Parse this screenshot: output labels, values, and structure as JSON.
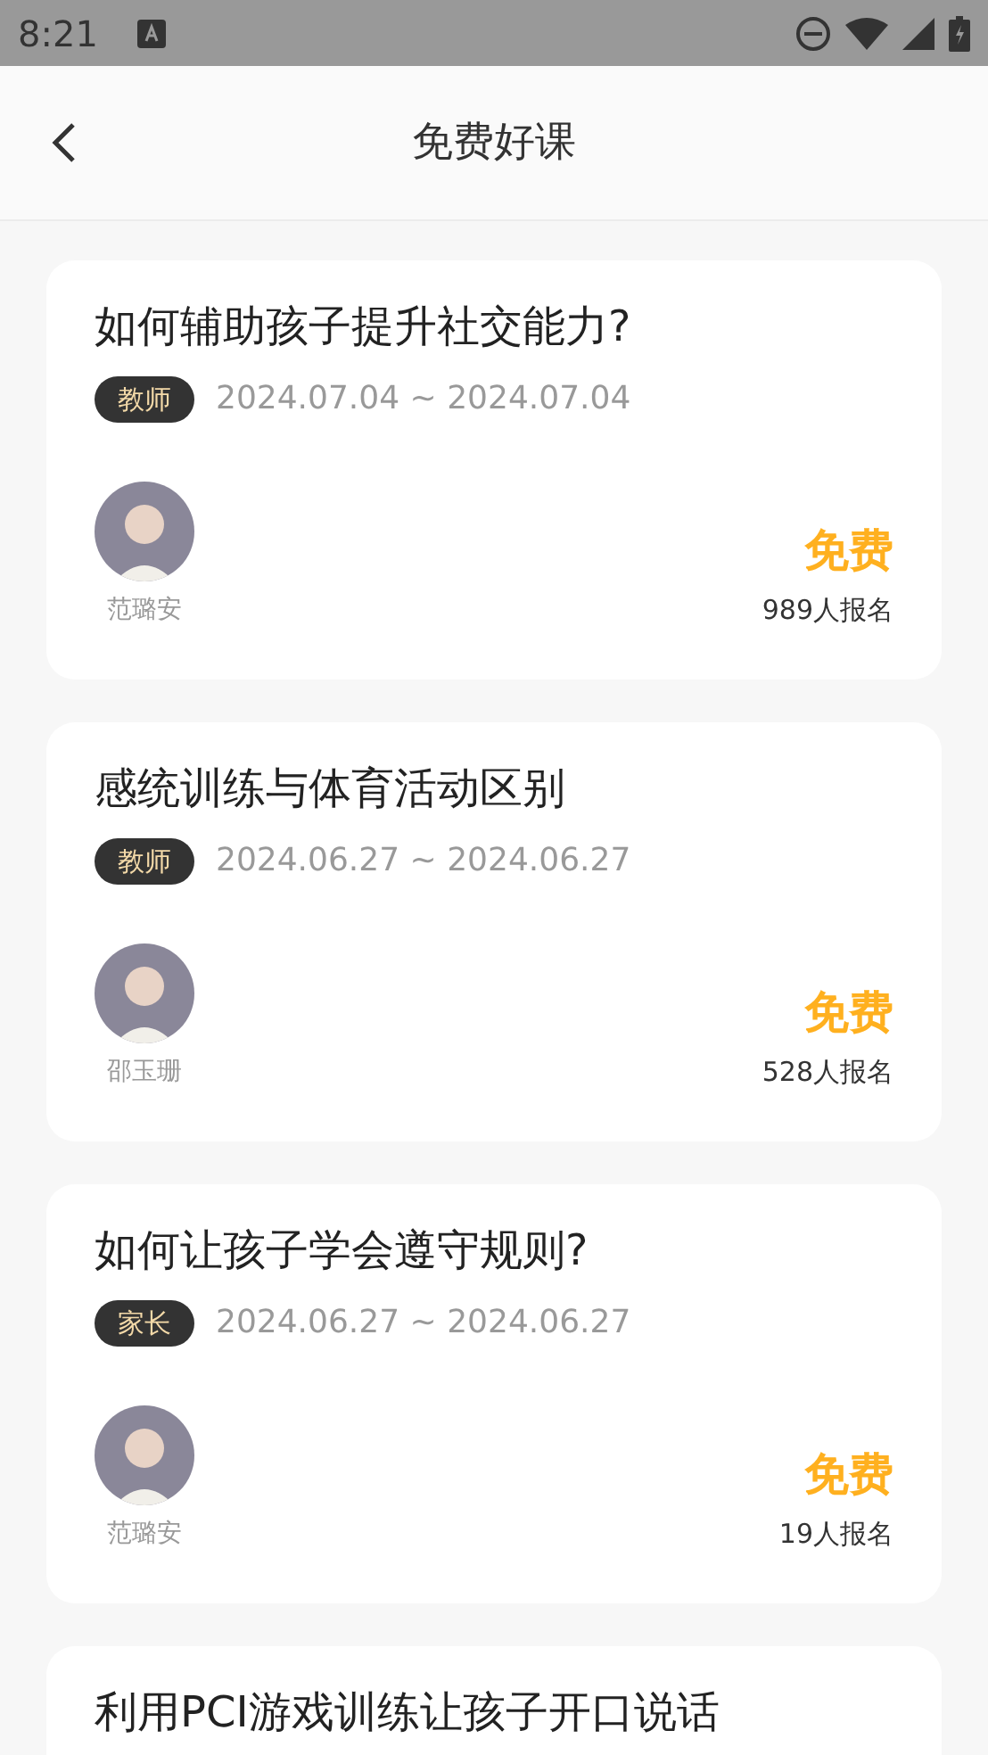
{
  "status_bar": {
    "time": "8:21"
  },
  "header": {
    "title": "免费好课"
  },
  "courses": [
    {
      "title": "如何辅助孩子提升社交能力?",
      "tag": "教师",
      "dates": "2024.07.04 ~ 2024.07.04",
      "teacher": "范璐安",
      "price": "免费",
      "enrolled": "989人报名"
    },
    {
      "title": "感统训练与体育活动区别",
      "tag": "教师",
      "dates": "2024.06.27 ~ 2024.06.27",
      "teacher": "邵玉珊",
      "price": "免费",
      "enrolled": "528人报名"
    },
    {
      "title": "如何让孩子学会遵守规则?",
      "tag": "家长",
      "dates": "2024.06.27 ~ 2024.06.27",
      "teacher": "范璐安",
      "price": "免费",
      "enrolled": "19人报名"
    },
    {
      "title": "利用PCI游戏训练让孩子开口说话"
    }
  ]
}
